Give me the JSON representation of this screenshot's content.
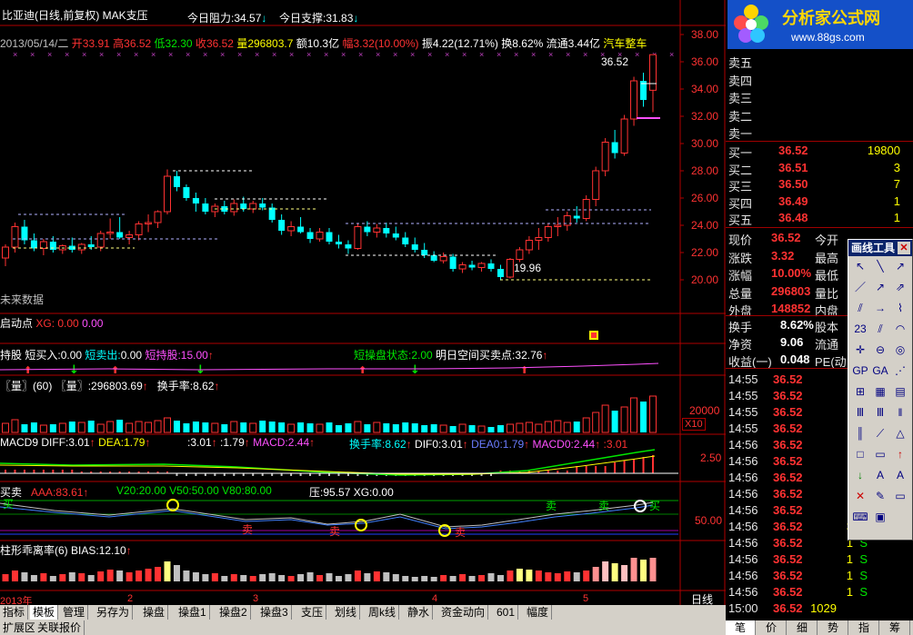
{
  "header": {
    "stock_title": "比亚迪(日线,前复权) MAK支压",
    "resistance_label": "今日阻力:",
    "resistance_value": "34.57",
    "support_label": "今日支撑:",
    "support_value": "31.83",
    "date": "2013/05/14/二",
    "open_label": "开",
    "open": "33.91",
    "high_label": "高",
    "high": "36.52",
    "low_label": "低",
    "low": "32.30",
    "close_label": "收",
    "close": "36.52",
    "vol_label": "量",
    "vol": "296803.7",
    "amount_label": "额",
    "amount": "10.3亿",
    "amp_label": "幅",
    "amp": "3.32(10.00%)",
    "swing_label": "振",
    "swing": "4.22(12.71%)",
    "turnover_label": "换",
    "turnover": "8.62%",
    "float_label": "流通",
    "float": "3.44亿",
    "industry": "汽车整车"
  },
  "price_axis": [
    "38.00",
    "36.00",
    "34.00",
    "32.00",
    "30.00",
    "28.00",
    "26.00",
    "24.00",
    "22.00",
    "20.00"
  ],
  "price_labels": {
    "high_mark": "36.52",
    "low_mark": "19.96"
  },
  "future_data_label": "未来数据",
  "panels": {
    "p1": {
      "title": "启动点",
      "k1": "XG:",
      "v1": "0.00",
      "v2": "0.00"
    },
    "p2": {
      "t1": "持股",
      "t2": "短买入:",
      "v2": "0.00",
      "t3": "短卖出:",
      "v3": "0.00",
      "t4": "短持股:",
      "v4": "15.00",
      "t5": "短操盘状态:",
      "v5": "2.00",
      "t6": "明日空间买卖点:",
      "v6": "32.76"
    },
    "p3": {
      "t1": "〖量〗(60)",
      "t2": "〖量〗:",
      "v2": "296803.69",
      "t3": "换手率:",
      "v3": "8.62",
      "axis": "20000",
      "unit": "X10"
    },
    "p4": {
      "t1": "MACD9",
      "t2": "DIFF:",
      "v2": "3.01",
      "t3": "DEA:",
      "v3": "1.79",
      "v4": ":3.01",
      "v5": ":1.79",
      "t6": "MACD:",
      "v6": "2.44",
      "t7": "换手率:",
      "v7": "8.62",
      "t8": "DIF0:",
      "v8": "3.01",
      "t9": "DEA0:",
      "v9": "1.79",
      "t10": "MACD0:",
      "v10": "2.44",
      "v11": ":3.01",
      "axis": "2.50"
    },
    "p5": {
      "t1": "买卖",
      "t2": "AAA:",
      "v2": "83.61",
      "t3": "V20:",
      "v3": "20.00",
      "t4": "V50:",
      "v4": "50.00",
      "t5": "V80:",
      "v5": "80.00",
      "t6": "压:",
      "v6": "95.57",
      "t7": "XG:",
      "v7": "0.00",
      "axis": "50.00",
      "buy": "买",
      "sell": "卖"
    },
    "p6": {
      "t1": "柱形乖离率(6)",
      "t2": "BIAS:",
      "v2": "12.10"
    }
  },
  "time_axis": [
    "2013年",
    "2",
    "3",
    "4",
    "5"
  ],
  "period_label": "日线",
  "tabs_row1": [
    "指标",
    "模板",
    "管理",
    "另存为",
    "操盘",
    "操盘1",
    "操盘2",
    "操盘3",
    "支压",
    "划线",
    "周k线",
    "静水",
    "资金动向",
    "601",
    "幅度"
  ],
  "tabs_row2": [
    "扩展区",
    "关联报价"
  ],
  "quote": {
    "logo_text": "分析家公式网",
    "logo_url": "www.88gs.com",
    "sell_levels": [
      "卖五",
      "卖四",
      "卖三",
      "卖二",
      "卖一"
    ],
    "buy_levels": [
      {
        "label": "买一",
        "price": "36.52",
        "vol": "19800"
      },
      {
        "label": "买二",
        "price": "36.51",
        "vol": "3"
      },
      {
        "label": "买三",
        "price": "36.50",
        "vol": "7"
      },
      {
        "label": "买四",
        "price": "36.49",
        "vol": "1"
      },
      {
        "label": "买五",
        "price": "36.48",
        "vol": "1"
      }
    ],
    "stats": [
      {
        "label": "现价",
        "value": "36.52",
        "label2": "今开"
      },
      {
        "label": "涨跌",
        "value": "3.32",
        "label2": "最高"
      },
      {
        "label": "涨幅",
        "value": "10.00%",
        "label2": "最低"
      },
      {
        "label": "总量",
        "value": "296803",
        "label2": "量比"
      },
      {
        "label": "外盘",
        "value": "148852",
        "label2": "内盘"
      }
    ],
    "stats2": [
      {
        "label": "换手",
        "value": "8.62%",
        "label2": "股本"
      },
      {
        "label": "净资",
        "value": "9.06",
        "label2": "流通"
      },
      {
        "label": "收益(一)",
        "value": "0.048",
        "label2": "PE(动"
      }
    ],
    "ticks": [
      {
        "time": "14:55",
        "price": "36.52"
      },
      {
        "time": "14:55",
        "price": "36.52"
      },
      {
        "time": "14:55",
        "price": "36.52"
      },
      {
        "time": "14:55",
        "price": "36.52"
      },
      {
        "time": "14:56",
        "price": "36.52"
      },
      {
        "time": "14:56",
        "price": "36.52"
      },
      {
        "time": "14:56",
        "price": "36.52"
      },
      {
        "time": "14:56",
        "price": "36.52"
      },
      {
        "time": "14:56",
        "price": "36.52"
      },
      {
        "time": "14:56",
        "price": "36.52",
        "vol": "3",
        "bs": "S"
      },
      {
        "time": "14:56",
        "price": "36.52",
        "vol": "1",
        "bs": "S"
      },
      {
        "time": "14:56",
        "price": "36.52",
        "vol": "1",
        "bs": "S"
      },
      {
        "time": "14:56",
        "price": "36.52",
        "vol": "1",
        "bs": "S"
      },
      {
        "time": "14:56",
        "price": "36.52",
        "vol": "1",
        "bs": "S"
      },
      {
        "time": "15:00",
        "price": "36.52",
        "vol": "1029"
      }
    ],
    "bottom_tabs": [
      "笔",
      "价",
      "细",
      "势",
      "指",
      "筹"
    ]
  },
  "drawtool": {
    "title": "画线工具",
    "close": "✕",
    "letter_a1": "A",
    "letter_a2": "A"
  },
  "colors": {
    "up": "#ff3232",
    "down": "#00ffff",
    "bg": "#000000",
    "axis": "#b00000"
  },
  "chart_data": {
    "type": "candlestick",
    "title": "比亚迪(日线,前复权) MAK支压",
    "ylim": [
      19.5,
      38.5
    ],
    "candles": [
      [
        21.6,
        22.6,
        21.0,
        22.4
      ],
      [
        22.4,
        24.2,
        22.0,
        23.9
      ],
      [
        23.9,
        24.4,
        22.6,
        22.9
      ],
      [
        22.9,
        23.4,
        22.1,
        22.3
      ],
      [
        22.3,
        23.0,
        21.8,
        22.8
      ],
      [
        22.8,
        23.2,
        22.0,
        22.2
      ],
      [
        22.2,
        22.6,
        21.9,
        22.5
      ],
      [
        22.5,
        23.1,
        22.0,
        22.2
      ],
      [
        22.2,
        22.7,
        21.9,
        22.6
      ],
      [
        22.6,
        23.2,
        22.2,
        22.4
      ],
      [
        22.4,
        23.6,
        22.1,
        23.4
      ],
      [
        23.4,
        24.5,
        23.0,
        23.5
      ],
      [
        23.5,
        24.6,
        23.0,
        23.1
      ],
      [
        23.1,
        23.6,
        22.6,
        23.3
      ],
      [
        23.3,
        24.3,
        22.9,
        24.1
      ],
      [
        24.1,
        24.8,
        23.5,
        24.2
      ],
      [
        24.2,
        25.1,
        23.8,
        25.0
      ],
      [
        25.0,
        28.1,
        24.8,
        27.6
      ],
      [
        27.6,
        28.0,
        26.5,
        26.8
      ],
      [
        26.8,
        27.0,
        25.8,
        26.0
      ],
      [
        26.0,
        26.4,
        25.0,
        25.6
      ],
      [
        25.6,
        26.0,
        24.8,
        25.0
      ],
      [
        25.0,
        25.6,
        24.6,
        25.4
      ],
      [
        25.4,
        25.8,
        24.8,
        25.0
      ],
      [
        25.0,
        25.9,
        24.7,
        25.6
      ],
      [
        25.6,
        26.1,
        25.0,
        25.2
      ],
      [
        25.2,
        25.8,
        24.9,
        25.6
      ],
      [
        25.6,
        26.0,
        25.1,
        25.3
      ],
      [
        25.3,
        25.6,
        24.2,
        24.4
      ],
      [
        24.4,
        24.8,
        23.3,
        23.6
      ],
      [
        23.6,
        24.3,
        23.2,
        23.9
      ],
      [
        23.9,
        24.6,
        23.4,
        23.5
      ],
      [
        23.5,
        23.8,
        22.7,
        23.0
      ],
      [
        23.0,
        23.8,
        22.8,
        23.5
      ],
      [
        23.5,
        23.8,
        22.6,
        22.8
      ],
      [
        22.8,
        23.3,
        22.3,
        22.6
      ],
      [
        22.6,
        22.9,
        21.9,
        22.3
      ],
      [
        22.3,
        24.1,
        22.2,
        23.9
      ],
      [
        23.9,
        24.3,
        23.2,
        23.5
      ],
      [
        23.5,
        24.1,
        23.1,
        23.8
      ],
      [
        23.8,
        24.2,
        23.1,
        23.4
      ],
      [
        23.4,
        23.9,
        22.9,
        23.1
      ],
      [
        23.1,
        23.5,
        22.4,
        22.6
      ],
      [
        22.6,
        23.1,
        22.0,
        22.2
      ],
      [
        22.2,
        22.7,
        21.6,
        21.8
      ],
      [
        21.8,
        22.1,
        21.3,
        21.4
      ],
      [
        21.4,
        22.0,
        21.2,
        21.7
      ],
      [
        21.7,
        21.9,
        20.6,
        20.8
      ],
      [
        20.8,
        21.3,
        20.5,
        21.1
      ],
      [
        21.1,
        21.4,
        20.7,
        20.9
      ],
      [
        20.9,
        21.3,
        20.6,
        21.2
      ],
      [
        21.2,
        21.5,
        20.6,
        20.8
      ],
      [
        20.8,
        21.1,
        19.96,
        20.2
      ],
      [
        20.2,
        21.6,
        20.1,
        21.5
      ],
      [
        21.5,
        22.4,
        21.3,
        22.2
      ],
      [
        22.2,
        23.2,
        21.9,
        22.9
      ],
      [
        22.9,
        23.8,
        22.2,
        23.1
      ],
      [
        23.1,
        24.1,
        22.8,
        23.9
      ],
      [
        23.9,
        24.6,
        23.2,
        24.0
      ],
      [
        24.0,
        25.0,
        23.6,
        24.7
      ],
      [
        24.7,
        25.4,
        24.2,
        24.5
      ],
      [
        24.5,
        26.2,
        24.3,
        25.9
      ],
      [
        25.9,
        28.3,
        25.4,
        28.0
      ],
      [
        28.0,
        30.4,
        27.6,
        30.1
      ],
      [
        30.1,
        31.0,
        28.9,
        29.3
      ],
      [
        29.3,
        32.1,
        29.1,
        31.8
      ],
      [
        31.8,
        34.9,
        31.3,
        34.6
      ],
      [
        34.6,
        35.2,
        32.7,
        33.2
      ],
      [
        33.91,
        36.52,
        32.3,
        36.52
      ]
    ]
  }
}
